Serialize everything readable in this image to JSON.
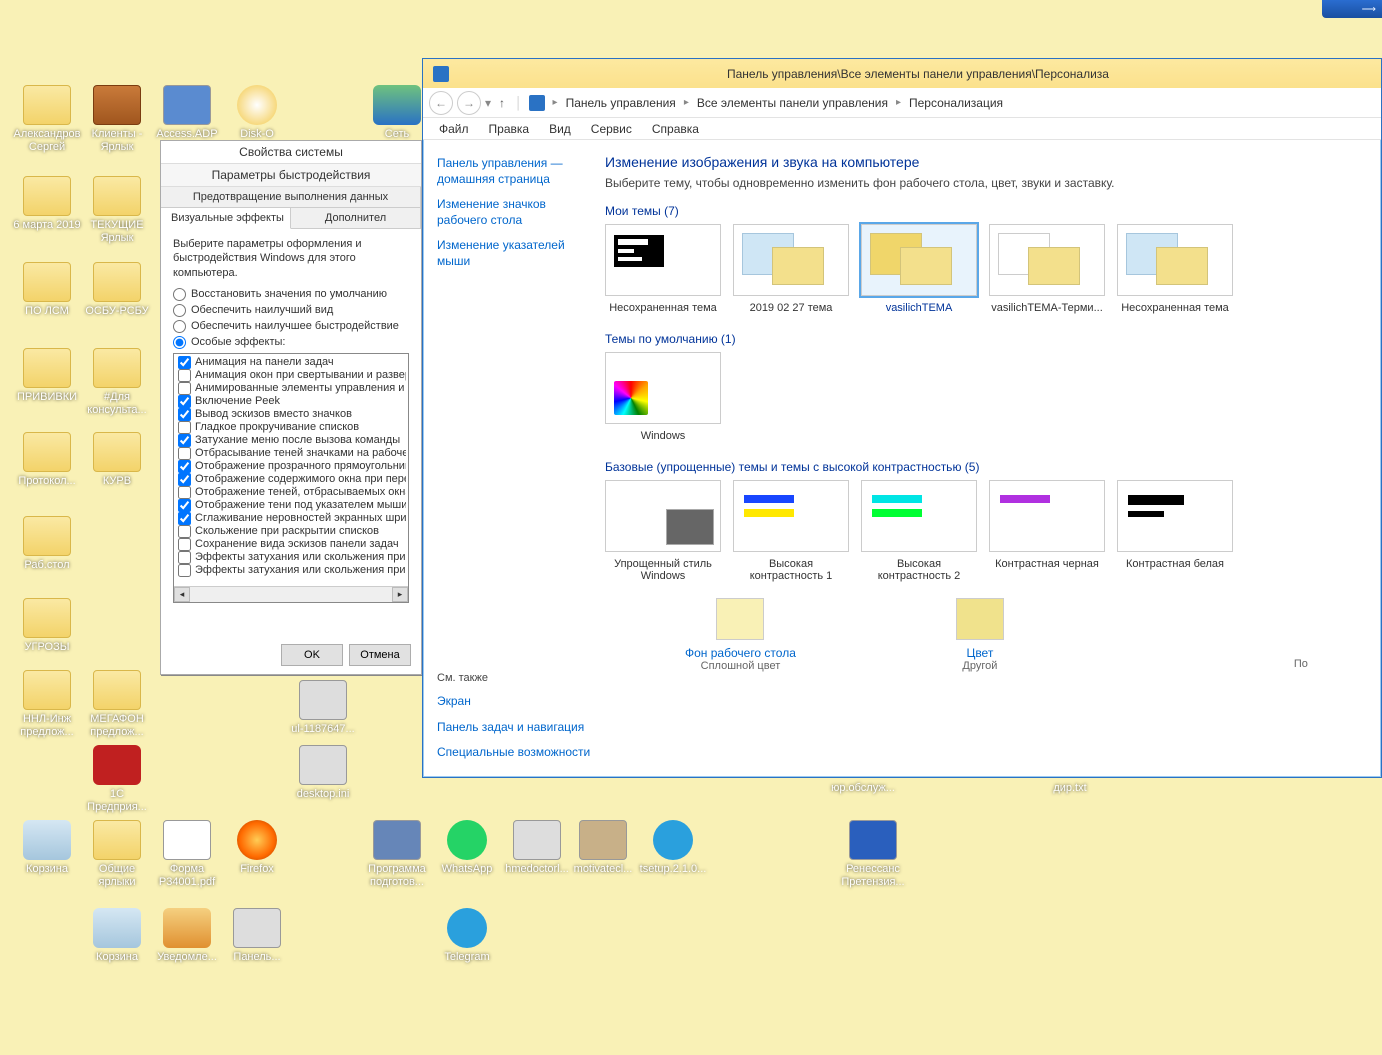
{
  "desktop_icons": {
    "col1": [
      {
        "label": "Александров Сергей"
      },
      {
        "label": "6 марта 2019"
      },
      {
        "label": "ПО ЛСМ"
      },
      {
        "label": "ПРИВИВКИ"
      },
      {
        "label": "Протокол..."
      },
      {
        "label": "Раб.стол"
      },
      {
        "label": "УГРОЗЫ"
      },
      {
        "label": "ННЛ-Инж предлож..."
      }
    ],
    "col2": [
      {
        "label": "Клиенты - Ярлык"
      },
      {
        "label": "ТЕКУЩИЕ Ярлык"
      },
      {
        "label": "ОСБУ-РСБУ"
      },
      {
        "label": "#Для консульта..."
      },
      {
        "label": "КУРВ"
      },
      {
        "label": ""
      },
      {
        "label": ""
      },
      {
        "label": "МЕГАФОН предлож..."
      },
      {
        "label": "1С Предприя..."
      }
    ],
    "bottom": [
      {
        "label": "Корзина"
      },
      {
        "label": "Общие ярлыки"
      },
      {
        "label": "Форма Р34001.pdf"
      },
      {
        "label": "Firefox"
      },
      {
        "label": "Программа подготов..."
      },
      {
        "label": "WhatsApp"
      },
      {
        "label": "hmedoctorl..."
      },
      {
        "label": "motivatecl..."
      },
      {
        "label": "tsetup.2.1.0..."
      },
      {
        "label": "Ренессанс Претензия..."
      }
    ],
    "bottom2": [
      {
        "label": "Корзина"
      },
      {
        "label": "Уведомле..."
      },
      {
        "label": "Панель..."
      },
      {
        "label": "Telegram"
      }
    ],
    "row1_others": [
      {
        "label": "Access.ADP"
      },
      {
        "label": "Disk-O"
      },
      {
        "label": "Сеть"
      }
    ],
    "misc": [
      {
        "label": "desktop.ini"
      },
      {
        "label": "ul-1187647..."
      },
      {
        "label": "юр.обслуж..."
      },
      {
        "label": "дир.txt"
      }
    ]
  },
  "perf_dialog": {
    "system_title": "Свойства системы",
    "title": "Параметры быстродействия",
    "tab_dep": "Предотвращение выполнения данных",
    "tab_visual": "Визуальные эффекты",
    "tab_adv": "Дополнител",
    "desc": "Выберите параметры оформления и быстродействия Windows для этого компьютера.",
    "radio_default": "Восстановить значения по умолчанию",
    "radio_best_look": "Обеспечить наилучший вид",
    "radio_best_perf": "Обеспечить наилучшее быстродействие",
    "radio_custom": "Особые эффекты:",
    "checks": [
      {
        "c": true,
        "t": "Анимация на панели задач"
      },
      {
        "c": false,
        "t": "Анимация окон при свертывании и развертыван"
      },
      {
        "c": false,
        "t": "Анимированные элементы управления и элемент"
      },
      {
        "c": true,
        "t": "Включение Peek"
      },
      {
        "c": true,
        "t": "Вывод эскизов вместо значков"
      },
      {
        "c": false,
        "t": "Гладкое прокручивание списков"
      },
      {
        "c": true,
        "t": "Затухание меню после вызова команды"
      },
      {
        "c": false,
        "t": "Отбрасывание теней значками на рабочем столе"
      },
      {
        "c": true,
        "t": "Отображение прозрачного прямоугольника выде"
      },
      {
        "c": true,
        "t": "Отображение содержимого окна при перетаскив"
      },
      {
        "c": false,
        "t": "Отображение теней, отбрасываемых окнами"
      },
      {
        "c": true,
        "t": "Отображение тени под указателем мыши"
      },
      {
        "c": true,
        "t": "Сглаживание неровностей экранных шрифтов"
      },
      {
        "c": false,
        "t": "Скольжение при раскрытии списков"
      },
      {
        "c": false,
        "t": "Сохранение вида эскизов панели задач"
      },
      {
        "c": false,
        "t": "Эффекты затухания или скольжения при обраще"
      },
      {
        "c": false,
        "t": "Эффекты затухания или скольжения при появле"
      }
    ],
    "ok": "OK",
    "cancel": "Отмена"
  },
  "explorer": {
    "window_title": "Панель управления\\Все элементы панели управления\\Персонализа",
    "crumb1": "Панель управления",
    "crumb2": "Все элементы панели управления",
    "crumb3": "Персонализация",
    "menu_file": "Файл",
    "menu_edit": "Правка",
    "menu_view": "Вид",
    "menu_service": "Сервис",
    "menu_help": "Справка",
    "side_home": "Панель управления — домашняя страница",
    "side_icons": "Изменение значков рабочего стола",
    "side_pointers": "Изменение указателей мыши",
    "side_also": "См. также",
    "side_screen": "Экран",
    "side_taskbar": "Панель задач и навигация",
    "side_access": "Специальные возможности",
    "heading": "Изменение изображения и звука на компьютере",
    "subheading": "Выберите тему, чтобы одновременно изменить фон рабочего стола, цвет, звуки и заставку.",
    "group_my": "Мои темы (7)",
    "group_default": "Темы по умолчанию (1)",
    "group_basic": "Базовые (упрощенные) темы и темы с высокой контрастностью (5)",
    "themes_my": [
      "Несохраненная тема",
      "2019 02 27 тема",
      "vasilichTEMA",
      "vasilichTEMA-Терми...",
      "Несохраненная тема"
    ],
    "theme_windows": "Windows",
    "themes_basic": [
      "Упрощенный стиль Windows",
      "Высокая контрастность 1",
      "Высокая контрастность 2",
      "Контрастная черная",
      "Контрастная белая"
    ],
    "bottom_bg": "Фон рабочего стола",
    "bottom_bg_sub": "Сплошной цвет",
    "bottom_color": "Цвет",
    "bottom_color_sub": "Другой",
    "bottom_more": "По"
  }
}
